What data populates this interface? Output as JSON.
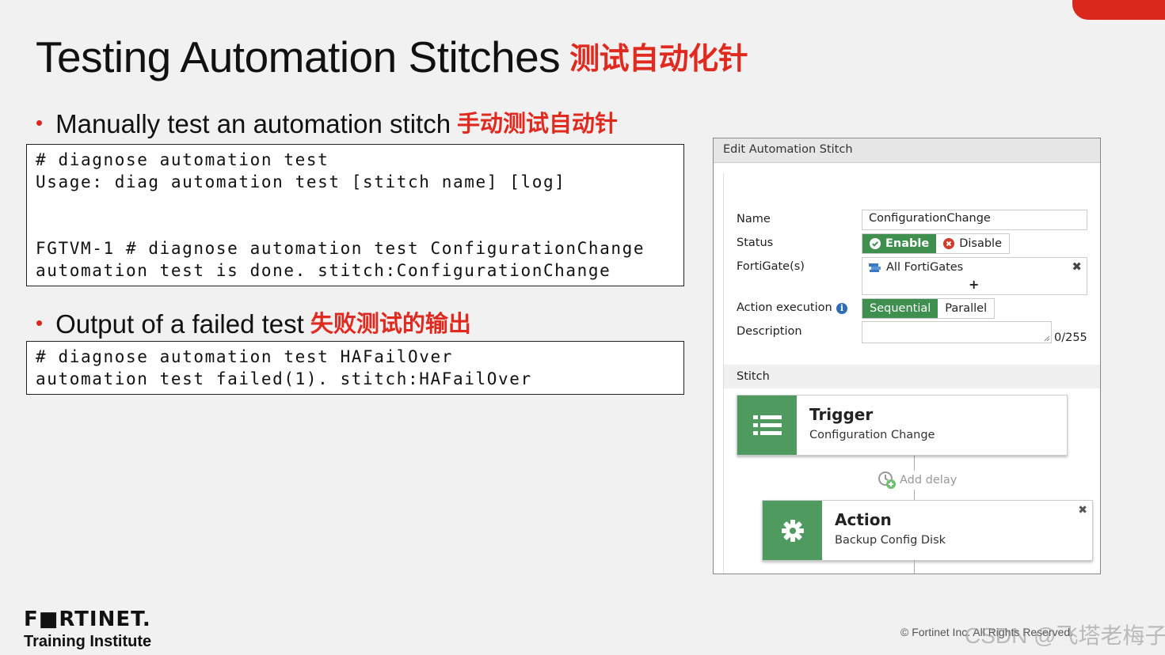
{
  "slide": {
    "title": "Testing Automation Stitches",
    "title_cn": "测试自动化针",
    "bullet1": "Manually test an automation stitch",
    "bullet1_cn": "手动测试自动针",
    "bullet2": "Output of a failed test",
    "bullet2_cn": "失败测试的输出",
    "bullet_glyph": "•"
  },
  "code1": {
    "lines": [
      "# diagnose automation test",
      "Usage: diag automation test [stitch name] [log]",
      "",
      "",
      "FGTVM-1 # diagnose automation test ConfigurationChange",
      "automation test is done. stitch:ConfigurationChange"
    ]
  },
  "code2": {
    "lines": [
      "# diagnose automation test HAFailOver",
      "automation test failed(1). stitch:HAFailOver"
    ]
  },
  "panel": {
    "header": "Edit Automation Stitch",
    "name_label": "Name",
    "name_value": "ConfigurationChange",
    "status_label": "Status",
    "enable_label": "Enable",
    "disable_label": "Disable",
    "fortigates_label": "FortiGate(s)",
    "fortigates_value": "All FortiGates",
    "add_symbol": "+",
    "remove_symbol": "✖",
    "action_exec_label": "Action execution",
    "info_symbol": "i",
    "sequential_label": "Sequential",
    "parallel_label": "Parallel",
    "description_label": "Description",
    "description_value": "",
    "description_count": "0/255",
    "stitch_label": "Stitch",
    "trigger_title": "Trigger",
    "trigger_sub": "Configuration Change",
    "add_delay_label": "Add delay",
    "action_title": "Action",
    "action_sub": "Backup Config Disk",
    "accent_color": "#3f8f4f"
  },
  "footer": {
    "logo": "F■RTINET.",
    "subtitle": "Training Institute",
    "copyright": "© Fortinet Inc. All Rights Reserved.",
    "watermark": "CSDN @飞塔老梅子"
  },
  "colors": {
    "brand_red": "#da291c",
    "cn_red": "#e02a1f",
    "green": "#4f9a5f"
  }
}
